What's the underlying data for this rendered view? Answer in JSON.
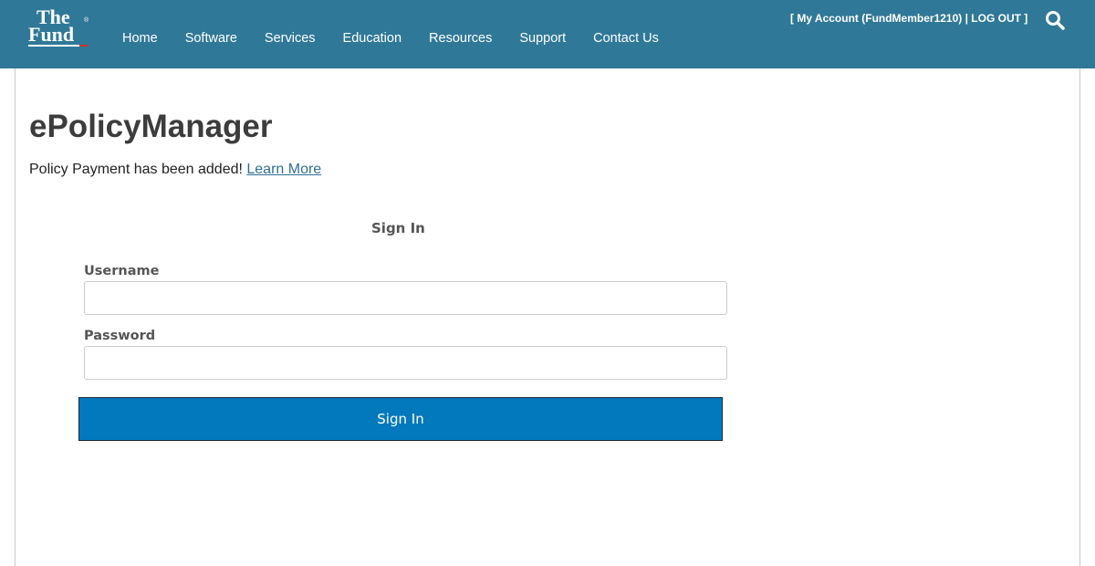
{
  "header": {
    "logo": {
      "line1": "The",
      "line2": "Fund",
      "trademark": "®"
    },
    "nav": [
      {
        "label": "Home"
      },
      {
        "label": "Software"
      },
      {
        "label": "Services"
      },
      {
        "label": "Education"
      },
      {
        "label": "Resources"
      },
      {
        "label": "Support"
      },
      {
        "label": "Contact Us"
      }
    ],
    "account": {
      "open_bracket": "[ ",
      "my_account_label": "My Account (FundMember1210)",
      "separator": " | ",
      "logout_label": "LOG OUT",
      "close_bracket": " ]"
    },
    "search_icon": "search-icon",
    "background_color": "#2f7898"
  },
  "main": {
    "title": "ePolicyManager",
    "notice_text": "Policy Payment has been added! ",
    "notice_link": "Learn More",
    "signin": {
      "heading": "Sign In",
      "username_label": "Username",
      "username_value": "",
      "password_label": "Password",
      "password_value": "",
      "button_label": "Sign In",
      "button_color": "#0278bd"
    }
  }
}
